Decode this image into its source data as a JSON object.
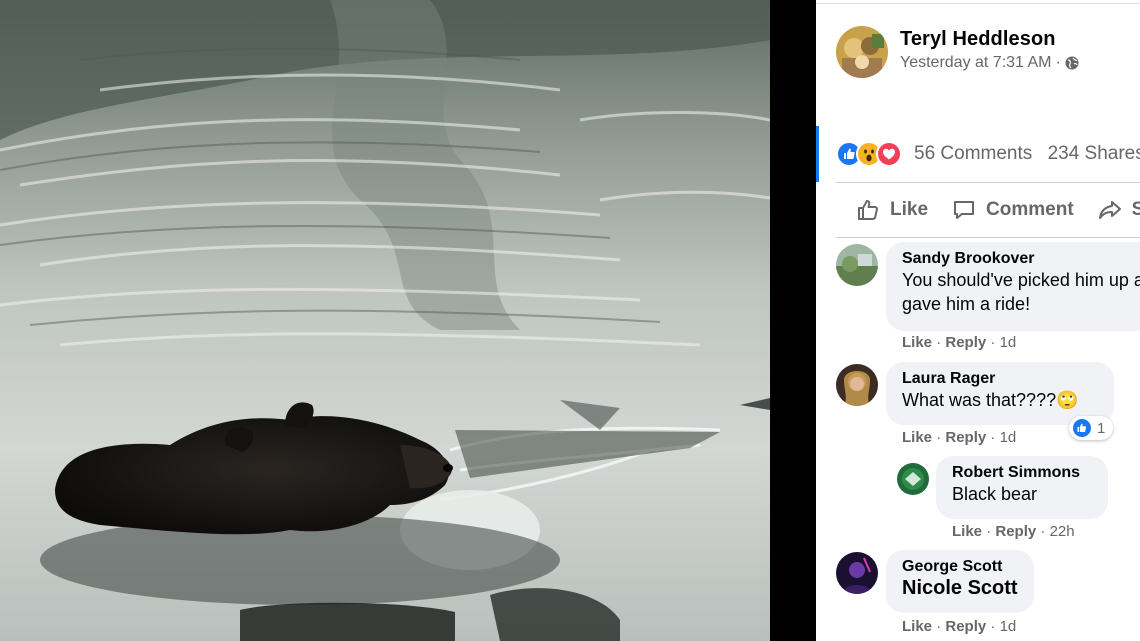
{
  "post": {
    "author": "Teryl Heddleson",
    "timestamp": "Yesterday at 7:31 AM",
    "separator": "·",
    "privacy_icon": "globe-icon",
    "reaction_icons": [
      "like-icon",
      "wow-icon",
      "love-icon"
    ],
    "comments_count": "56 Comments",
    "shares_count": "234 Shares"
  },
  "actions": {
    "like": "Like",
    "comment": "Comment",
    "share": "Share"
  },
  "comments": [
    {
      "name": "Sandy Brookover",
      "text_line1": "You should've picked him up and",
      "text_line2": "gave him a ride!",
      "like": "Like",
      "reply": "Reply",
      "sep": "·",
      "time": "1d"
    },
    {
      "name": "Laura Rager",
      "text": "What was that????",
      "emoji": "🙄",
      "reaction_count": "1",
      "like": "Like",
      "reply": "Reply",
      "sep": "·",
      "time": "1d"
    },
    {
      "name": "Robert Simmons",
      "text": "Black bear",
      "like": "Like",
      "reply": "Reply",
      "sep": "·",
      "time": "22h"
    },
    {
      "name": "George Scott",
      "text": "Nicole Scott",
      "like": "Like",
      "reply": "Reply",
      "sep": "·",
      "time": "1d"
    }
  ],
  "colors": {
    "accent": "#1877f2",
    "secondary_text": "#65676b",
    "bubble": "#f0f2f5",
    "love": "#f33e58",
    "wow": "#f7b125"
  }
}
